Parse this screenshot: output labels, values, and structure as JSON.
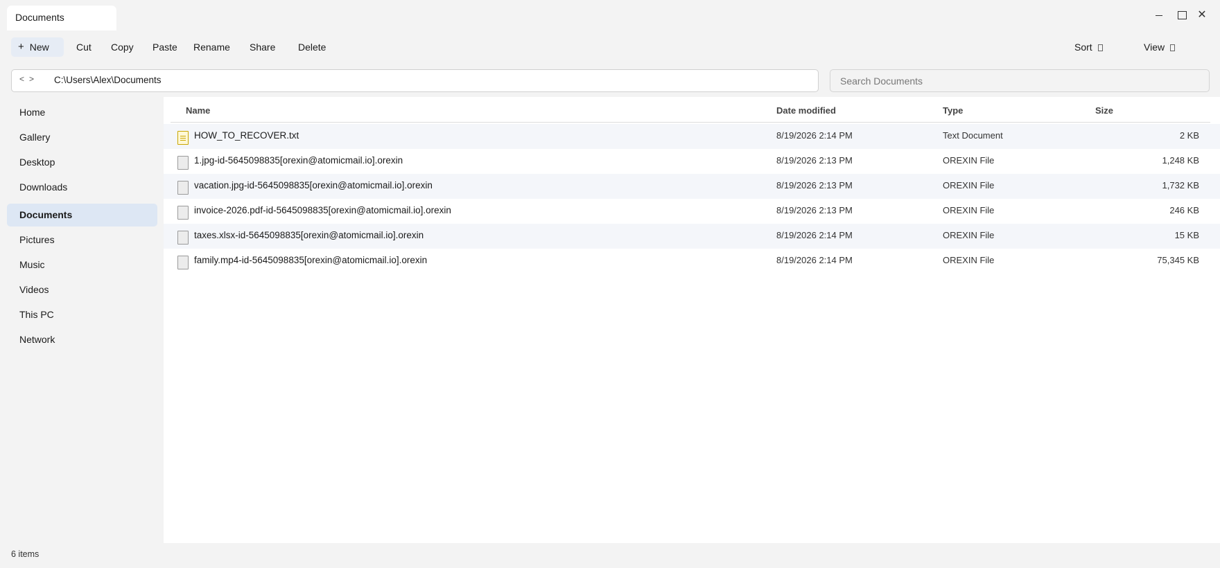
{
  "window": {
    "tab_title": "Documents"
  },
  "toolbar": {
    "new_label": "New",
    "cut_label": "Cut",
    "copy_label": "Copy",
    "paste_label": "Paste",
    "rename_label": "Rename",
    "share_label": "Share",
    "delete_label": "Delete",
    "sort_label": "Sort",
    "view_label": "View"
  },
  "address": {
    "path": "C:\\Users\\Alex\\Documents",
    "back": "<",
    "forward": ">"
  },
  "search": {
    "placeholder": "Search Documents"
  },
  "sidebar": {
    "items": [
      {
        "label": "Home"
      },
      {
        "label": "Gallery"
      },
      {
        "label": "Desktop"
      },
      {
        "label": "Downloads"
      },
      {
        "label": "Documents",
        "active": true
      },
      {
        "label": "Pictures"
      },
      {
        "label": "Music"
      },
      {
        "label": "Videos"
      },
      {
        "label": "This PC"
      },
      {
        "label": "Network"
      }
    ]
  },
  "table": {
    "columns": {
      "name": "Name",
      "date": "Date modified",
      "type": "Type",
      "size": "Size"
    },
    "rows": [
      {
        "name": "HOW_TO_RECOVER.txt",
        "date": "8/19/2026 2:14 PM",
        "type": "Text Document",
        "size": "2 KB",
        "icon": "text-file-icon"
      },
      {
        "name": "1.jpg-id-5645098835[orexin@atomicmail.io].orexin",
        "date": "8/19/2026 2:13 PM",
        "type": "OREXIN File",
        "size": "1,248 KB",
        "icon": "file-icon"
      },
      {
        "name": "vacation.jpg-id-5645098835[orexin@atomicmail.io].orexin",
        "date": "8/19/2026 2:13 PM",
        "type": "OREXIN File",
        "size": "1,732 KB",
        "icon": "file-icon"
      },
      {
        "name": "invoice-2026.pdf-id-5645098835[orexin@atomicmail.io].orexin",
        "date": "8/19/2026 2:13 PM",
        "type": "OREXIN File",
        "size": "246 KB",
        "icon": "file-icon"
      },
      {
        "name": "taxes.xlsx-id-5645098835[orexin@atomicmail.io].orexin",
        "date": "8/19/2026 2:14 PM",
        "type": "OREXIN File",
        "size": "15 KB",
        "icon": "file-icon"
      },
      {
        "name": "family.mp4-id-5645098835[orexin@atomicmail.io].orexin",
        "date": "8/19/2026 2:14 PM",
        "type": "OREXIN File",
        "size": "75,345 KB",
        "icon": "file-icon"
      }
    ]
  },
  "status": {
    "item_count": "6 items"
  }
}
